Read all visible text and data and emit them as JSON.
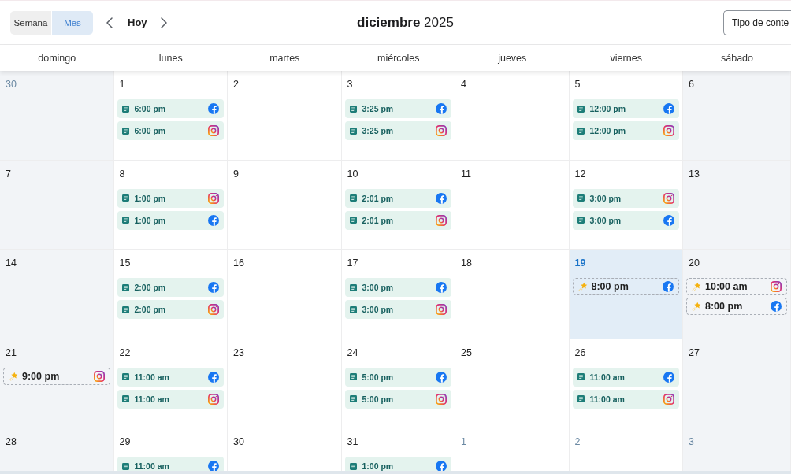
{
  "toolbar": {
    "view_toggle": [
      {
        "label": "Semana",
        "selected": false
      },
      {
        "label": "Mes",
        "selected": true
      }
    ],
    "today_button": "Hoy",
    "title": "**diciembre** 2025",
    "content_type_button": "Tipo de conte"
  },
  "weekdays": [
    {
      "label": "domingo",
      "weekend": true
    },
    {
      "label": "lunes",
      "weekend": false
    },
    {
      "label": "martes",
      "weekend": false
    },
    {
      "label": "miércoles",
      "weekend": false
    },
    {
      "label": "jueves",
      "weekend": false
    },
    {
      "label": "viernes",
      "weekend": false
    },
    {
      "label": "sábado",
      "weekend": true
    }
  ],
  "weeks": [
    {
      "days": [
        {
          "day": "30",
          "outside_month": true,
          "today": false
        },
        {
          "day": "1",
          "outside_month": false,
          "today": false,
          "posts": [
            {
              "kind": "facebook",
              "draft": false,
              "time": "6:00 pm"
            },
            {
              "kind": "instagram",
              "draft": false,
              "time": "6:00 pm"
            }
          ]
        },
        {
          "day": "2",
          "outside_month": false,
          "today": false
        },
        {
          "day": "3",
          "outside_month": false,
          "today": false,
          "posts": [
            {
              "kind": "facebook",
              "draft": false,
              "time": "3:25 pm"
            },
            {
              "kind": "instagram",
              "draft": false,
              "time": "3:25 pm"
            }
          ]
        },
        {
          "day": "4",
          "outside_month": false,
          "today": false
        },
        {
          "day": "5",
          "outside_month": false,
          "today": false,
          "posts": [
            {
              "kind": "facebook",
              "draft": false,
              "time": "12:00 pm"
            },
            {
              "kind": "instagram",
              "draft": false,
              "time": "12:00 pm"
            }
          ]
        },
        {
          "day": "6",
          "outside_month": false,
          "today": false
        }
      ]
    },
    {
      "days": [
        {
          "day": "7",
          "outside_month": false,
          "today": false
        },
        {
          "day": "8",
          "outside_month": false,
          "today": false,
          "posts": [
            {
              "kind": "instagram",
              "draft": false,
              "time": "1:00 pm"
            },
            {
              "kind": "facebook",
              "draft": false,
              "time": "1:00 pm"
            }
          ]
        },
        {
          "day": "9",
          "outside_month": false,
          "today": false
        },
        {
          "day": "10",
          "outside_month": false,
          "today": false,
          "posts": [
            {
              "kind": "facebook",
              "draft": false,
              "time": "2:01 pm"
            },
            {
              "kind": "instagram",
              "draft": false,
              "time": "2:01 pm"
            }
          ]
        },
        {
          "day": "11",
          "outside_month": false,
          "today": false
        },
        {
          "day": "12",
          "outside_month": false,
          "today": false,
          "posts": [
            {
              "kind": "instagram",
              "draft": false,
              "time": "3:00 pm"
            },
            {
              "kind": "facebook",
              "draft": false,
              "time": "3:00 pm"
            }
          ]
        },
        {
          "day": "13",
          "outside_month": false,
          "today": false
        }
      ]
    },
    {
      "days": [
        {
          "day": "14",
          "outside_month": false,
          "today": false
        },
        {
          "day": "15",
          "outside_month": false,
          "today": false,
          "posts": [
            {
              "kind": "facebook",
              "draft": false,
              "time": "2:00 pm"
            },
            {
              "kind": "instagram",
              "draft": false,
              "time": "2:00 pm"
            }
          ]
        },
        {
          "day": "16",
          "outside_month": false,
          "today": false
        },
        {
          "day": "17",
          "outside_month": false,
          "today": false,
          "posts": [
            {
              "kind": "facebook",
              "draft": false,
              "time": "3:00 pm"
            },
            {
              "kind": "instagram",
              "draft": false,
              "time": "3:00 pm"
            }
          ]
        },
        {
          "day": "18",
          "outside_month": false,
          "today": false
        },
        {
          "day": "19",
          "outside_month": false,
          "today": true,
          "posts": [
            {
              "kind": "facebook",
              "draft": true,
              "time": "8:00 pm"
            }
          ]
        },
        {
          "day": "20",
          "outside_month": false,
          "today": false,
          "posts": [
            {
              "kind": "instagram",
              "draft": true,
              "time": "10:00 am"
            },
            {
              "kind": "facebook",
              "draft": true,
              "time": "8:00 pm"
            }
          ]
        }
      ]
    },
    {
      "days": [
        {
          "day": "21",
          "outside_month": false,
          "today": false,
          "posts": [
            {
              "kind": "instagram",
              "draft": true,
              "time": "9:00 pm"
            }
          ]
        },
        {
          "day": "22",
          "outside_month": false,
          "today": false,
          "posts": [
            {
              "kind": "facebook",
              "draft": false,
              "time": "11:00 am"
            },
            {
              "kind": "instagram",
              "draft": false,
              "time": "11:00 am"
            }
          ]
        },
        {
          "day": "23",
          "outside_month": false,
          "today": false
        },
        {
          "day": "24",
          "outside_month": false,
          "today": false,
          "posts": [
            {
              "kind": "facebook",
              "draft": false,
              "time": "5:00 pm"
            },
            {
              "kind": "instagram",
              "draft": false,
              "time": "5:00 pm"
            }
          ]
        },
        {
          "day": "25",
          "outside_month": false,
          "today": false
        },
        {
          "day": "26",
          "outside_month": false,
          "today": false,
          "posts": [
            {
              "kind": "facebook",
              "draft": false,
              "time": "11:00 am"
            },
            {
              "kind": "instagram",
              "draft": false,
              "time": "11:00 am"
            }
          ]
        },
        {
          "day": "27",
          "outside_month": false,
          "today": false
        }
      ]
    },
    {
      "days": [
        {
          "day": "28",
          "outside_month": false,
          "today": false
        },
        {
          "day": "29",
          "outside_month": false,
          "today": false,
          "posts": [
            {
              "kind": "facebook",
              "draft": false,
              "time": "11:00 am"
            }
          ]
        },
        {
          "day": "30",
          "outside_month": false,
          "today": false
        },
        {
          "day": "31",
          "outside_month": false,
          "today": false,
          "posts": [
            {
              "kind": "facebook",
              "draft": false,
              "time": "1:00 pm"
            }
          ]
        },
        {
          "day": "1",
          "outside_month": true,
          "today": false
        },
        {
          "day": "2",
          "outside_month": true,
          "today": false
        },
        {
          "day": "3",
          "outside_month": true,
          "today": false
        }
      ]
    }
  ]
}
